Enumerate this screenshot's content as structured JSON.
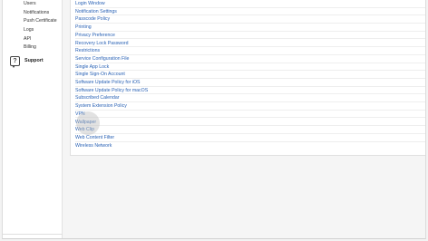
{
  "sidebar": {
    "items": [
      {
        "label": "Users"
      },
      {
        "label": "Notifications"
      },
      {
        "label": "Push Certificate"
      },
      {
        "label": "Logs"
      },
      {
        "label": "API"
      },
      {
        "label": "Billing"
      }
    ],
    "support": {
      "label": "Support",
      "icon": "help-question-icon"
    }
  },
  "main": {
    "payloads": [
      "Login Window",
      "Notification Settings",
      "Passcode Policy",
      "Printing",
      "Privacy Preference",
      "Recovery Lock Password",
      "Restrictions",
      "Service Configuration File",
      "Single App Lock",
      "Single Sign-On Account",
      "Software Update Policy for iOS",
      "Software Update Policy for macOS",
      "Subscribed Calendar",
      "System Extension Policy",
      "VPN",
      "Wallpaper",
      "Web Clip",
      "Web Content Filter",
      "Wireless Network"
    ],
    "link_color": "#2a62b5"
  }
}
